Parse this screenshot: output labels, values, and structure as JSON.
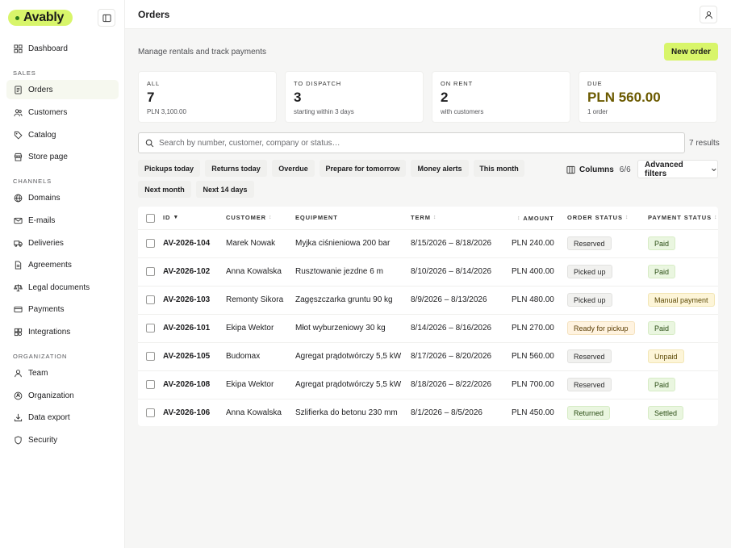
{
  "app": {
    "logo_text": "Avably"
  },
  "sidebar": {
    "items_top": [
      {
        "label": "Dashboard",
        "icon": "grid-icon"
      }
    ],
    "section_sales": "SALES",
    "items_sales": [
      {
        "label": "Orders",
        "icon": "receipt-icon"
      },
      {
        "label": "Customers",
        "icon": "users-icon"
      },
      {
        "label": "Catalog",
        "icon": "tag-icon"
      },
      {
        "label": "Store page",
        "icon": "store-icon"
      }
    ],
    "section_channels": "CHANNELS",
    "items_channels": [
      {
        "label": "Domains",
        "icon": "globe-icon"
      },
      {
        "label": "E-mails",
        "icon": "mail-icon"
      },
      {
        "label": "Deliveries",
        "icon": "truck-icon"
      },
      {
        "label": "Agreements",
        "icon": "document-icon"
      },
      {
        "label": "Legal documents",
        "icon": "scale-icon"
      },
      {
        "label": "Payments",
        "icon": "card-icon"
      },
      {
        "label": "Integrations",
        "icon": "plug-icon"
      }
    ],
    "section_org": "ORGANIZATION",
    "items_org": [
      {
        "label": "Team",
        "icon": "user-icon"
      },
      {
        "label": "Organization",
        "icon": "building-icon"
      },
      {
        "label": "Data export",
        "icon": "download-icon"
      },
      {
        "label": "Security",
        "icon": "shield-icon"
      }
    ]
  },
  "header": {
    "title": "Orders"
  },
  "main": {
    "subtitle": "Manage rentals and track payments",
    "new_order_label": "New order",
    "stats": [
      {
        "label": "ALL",
        "value": "7",
        "sub": "PLN 3,100.00"
      },
      {
        "label": "TO DISPATCH",
        "value": "3",
        "sub": "starting within 3 days"
      },
      {
        "label": "ON RENT",
        "value": "2",
        "sub": "with customers"
      },
      {
        "label": "DUE",
        "value": "PLN 560.00",
        "sub": "1 order"
      }
    ],
    "search_placeholder": "Search by number, customer, company or status…",
    "results": "7 results",
    "quick_filters": [
      "Pickups today",
      "Returns today",
      "Overdue",
      "Prepare for tomorrow",
      "Money alerts",
      "This month",
      "Next month",
      "Next 14 days"
    ],
    "columns_label": "Columns",
    "columns_count": "6/6",
    "advanced_filters_label": "Advanced filters"
  },
  "table": {
    "headers": {
      "id": "ID",
      "customer": "CUSTOMER",
      "equipment": "EQUIPMENT",
      "term": "TERM",
      "amount": "AMOUNT",
      "order_status": "ORDER STATUS",
      "payment_status": "PAYMENT STATUS"
    },
    "rows": [
      {
        "id": "AV-2026-104",
        "customer": "Marek Nowak",
        "equipment": "Myjka ciśnieniowa 200 bar",
        "term": "8/15/2026 – 8/18/2026",
        "amount": "PLN 240.00",
        "order_status": "Reserved",
        "payment_status": "Paid"
      },
      {
        "id": "AV-2026-102",
        "customer": "Anna Kowalska",
        "equipment": "Rusztowanie jezdne 6 m",
        "term": "8/10/2026 – 8/14/2026",
        "amount": "PLN 400.00",
        "order_status": "Picked up",
        "payment_status": "Paid"
      },
      {
        "id": "AV-2026-103",
        "customer": "Remonty Sikora",
        "equipment": "Zagęszczarka gruntu 90 kg",
        "term": "8/9/2026 – 8/13/2026",
        "amount": "PLN 480.00",
        "order_status": "Picked up",
        "payment_status": "Manual payment"
      },
      {
        "id": "AV-2026-101",
        "customer": "Ekipa Wektor",
        "equipment": "Młot wyburzeniowy 30 kg",
        "term": "8/14/2026 – 8/16/2026",
        "amount": "PLN 270.00",
        "order_status": "Ready for pickup",
        "payment_status": "Paid"
      },
      {
        "id": "AV-2026-105",
        "customer": "Budomax",
        "equipment": "Agregat prądotwórczy 5,5 kW",
        "term": "8/17/2026 – 8/20/2026",
        "amount": "PLN 560.00",
        "order_status": "Reserved",
        "payment_status": "Unpaid"
      },
      {
        "id": "AV-2026-108",
        "customer": "Ekipa Wektor",
        "equipment": "Agregat prądotwórczy 5,5 kW",
        "term": "8/18/2026 – 8/22/2026",
        "amount": "PLN 700.00",
        "order_status": "Reserved",
        "payment_status": "Paid"
      },
      {
        "id": "AV-2026-106",
        "customer": "Anna Kowalska",
        "equipment": "Szlifierka do betonu 230 mm",
        "term": "8/1/2026 – 8/5/2026",
        "amount": "PLN 450.00",
        "order_status": "Returned",
        "payment_status": "Settled"
      }
    ]
  },
  "colors": {
    "accent": "#d8f56a",
    "due_value": "#6b5a00"
  }
}
